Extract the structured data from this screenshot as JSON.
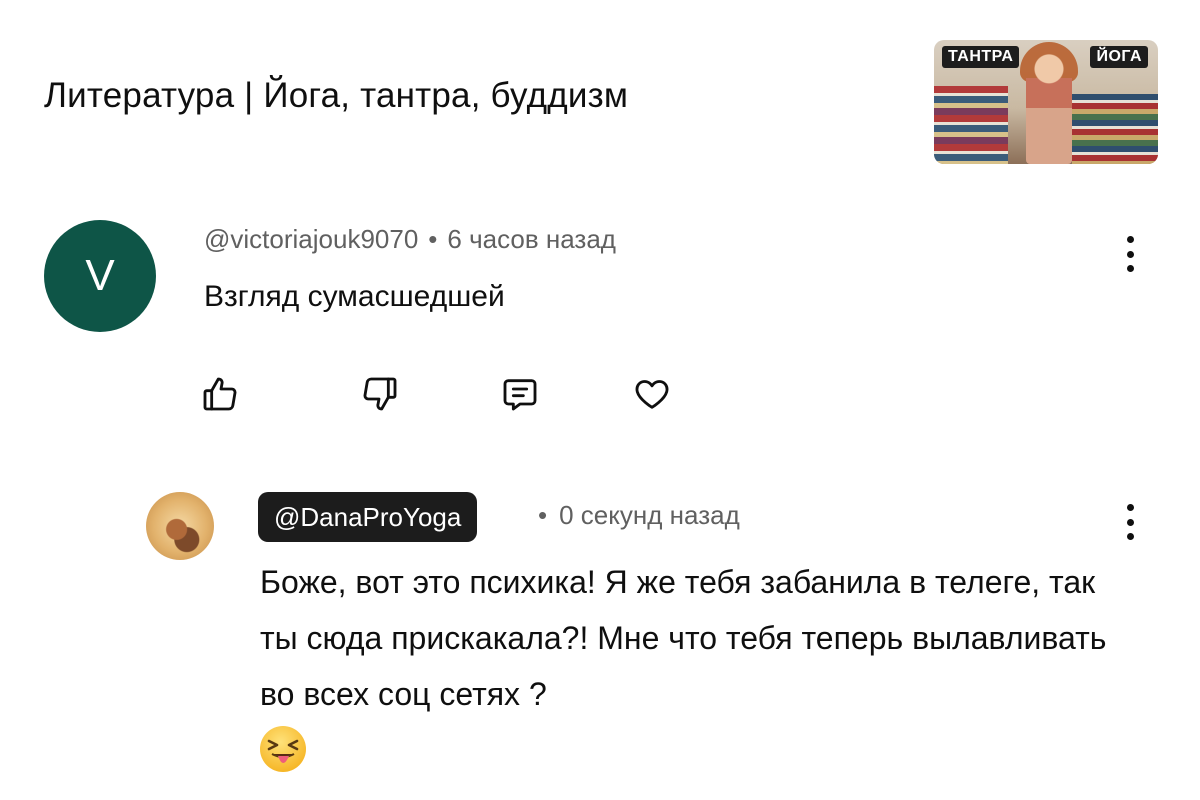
{
  "video": {
    "title": "Литература | Йога, тантра, буддизм",
    "thumbnail": {
      "tag_left": "ТАНТРА",
      "tag_right": "ЙОГА"
    }
  },
  "comments": [
    {
      "avatar_letter": "V",
      "avatar_color": "#0e5547",
      "author": "@victoriajouk9070",
      "separator": "•",
      "time": "6 часов назад",
      "text": "Взгляд сумасшедшей",
      "actions": [
        "thumbs-up-icon",
        "thumbs-down-icon",
        "reply-icon",
        "heart-icon"
      ]
    },
    {
      "author": "@DanaProYoga",
      "author_is_channel_owner": true,
      "separator": "•",
      "time": "0 секунд назад",
      "text": "Боже, вот это психика! Я же тебя забанила в телеге, так ты сюда прискакала?! Мне что тебя теперь вылавливать во всех соц сетях ?",
      "emoji": "😝"
    }
  ],
  "colors": {
    "meta_text": "#606060",
    "owner_pill": "#1c1c1c"
  }
}
